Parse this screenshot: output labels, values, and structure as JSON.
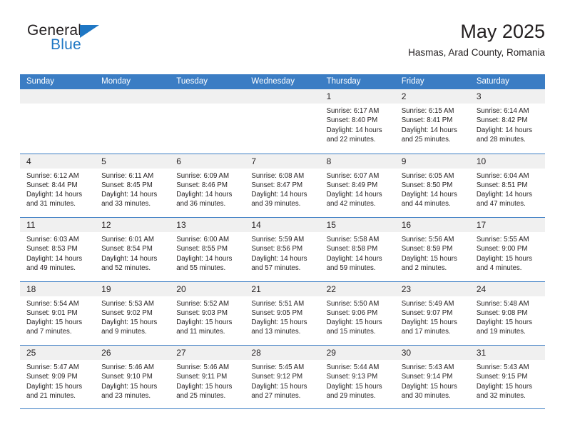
{
  "brand": {
    "word_one": "General",
    "word_two": "Blue",
    "triangle_icon": "brand-triangle-icon",
    "accent_color": "#1f77c4"
  },
  "header": {
    "month_title": "May 2025",
    "location": "Hasmas, Arad County, Romania"
  },
  "theme": {
    "header_bg": "#3b7dc4",
    "header_text": "#ffffff",
    "day_band_bg": "#f0f0f0",
    "cell_bg": "#ffffff",
    "text": "#231f20"
  },
  "weekdays": [
    "Sunday",
    "Monday",
    "Tuesday",
    "Wednesday",
    "Thursday",
    "Friday",
    "Saturday"
  ],
  "weeks": [
    [
      {
        "day": "",
        "sunrise": "",
        "sunset": "",
        "daylight_1": "",
        "daylight_2": "",
        "empty": true
      },
      {
        "day": "",
        "sunrise": "",
        "sunset": "",
        "daylight_1": "",
        "daylight_2": "",
        "empty": true
      },
      {
        "day": "",
        "sunrise": "",
        "sunset": "",
        "daylight_1": "",
        "daylight_2": "",
        "empty": true
      },
      {
        "day": "",
        "sunrise": "",
        "sunset": "",
        "daylight_1": "",
        "daylight_2": "",
        "empty": true
      },
      {
        "day": "1",
        "sunrise": "Sunrise: 6:17 AM",
        "sunset": "Sunset: 8:40 PM",
        "daylight_1": "Daylight: 14 hours",
        "daylight_2": "and 22 minutes."
      },
      {
        "day": "2",
        "sunrise": "Sunrise: 6:15 AM",
        "sunset": "Sunset: 8:41 PM",
        "daylight_1": "Daylight: 14 hours",
        "daylight_2": "and 25 minutes."
      },
      {
        "day": "3",
        "sunrise": "Sunrise: 6:14 AM",
        "sunset": "Sunset: 8:42 PM",
        "daylight_1": "Daylight: 14 hours",
        "daylight_2": "and 28 minutes."
      }
    ],
    [
      {
        "day": "4",
        "sunrise": "Sunrise: 6:12 AM",
        "sunset": "Sunset: 8:44 PM",
        "daylight_1": "Daylight: 14 hours",
        "daylight_2": "and 31 minutes."
      },
      {
        "day": "5",
        "sunrise": "Sunrise: 6:11 AM",
        "sunset": "Sunset: 8:45 PM",
        "daylight_1": "Daylight: 14 hours",
        "daylight_2": "and 33 minutes."
      },
      {
        "day": "6",
        "sunrise": "Sunrise: 6:09 AM",
        "sunset": "Sunset: 8:46 PM",
        "daylight_1": "Daylight: 14 hours",
        "daylight_2": "and 36 minutes."
      },
      {
        "day": "7",
        "sunrise": "Sunrise: 6:08 AM",
        "sunset": "Sunset: 8:47 PM",
        "daylight_1": "Daylight: 14 hours",
        "daylight_2": "and 39 minutes."
      },
      {
        "day": "8",
        "sunrise": "Sunrise: 6:07 AM",
        "sunset": "Sunset: 8:49 PM",
        "daylight_1": "Daylight: 14 hours",
        "daylight_2": "and 42 minutes."
      },
      {
        "day": "9",
        "sunrise": "Sunrise: 6:05 AM",
        "sunset": "Sunset: 8:50 PM",
        "daylight_1": "Daylight: 14 hours",
        "daylight_2": "and 44 minutes."
      },
      {
        "day": "10",
        "sunrise": "Sunrise: 6:04 AM",
        "sunset": "Sunset: 8:51 PM",
        "daylight_1": "Daylight: 14 hours",
        "daylight_2": "and 47 minutes."
      }
    ],
    [
      {
        "day": "11",
        "sunrise": "Sunrise: 6:03 AM",
        "sunset": "Sunset: 8:53 PM",
        "daylight_1": "Daylight: 14 hours",
        "daylight_2": "and 49 minutes."
      },
      {
        "day": "12",
        "sunrise": "Sunrise: 6:01 AM",
        "sunset": "Sunset: 8:54 PM",
        "daylight_1": "Daylight: 14 hours",
        "daylight_2": "and 52 minutes."
      },
      {
        "day": "13",
        "sunrise": "Sunrise: 6:00 AM",
        "sunset": "Sunset: 8:55 PM",
        "daylight_1": "Daylight: 14 hours",
        "daylight_2": "and 55 minutes."
      },
      {
        "day": "14",
        "sunrise": "Sunrise: 5:59 AM",
        "sunset": "Sunset: 8:56 PM",
        "daylight_1": "Daylight: 14 hours",
        "daylight_2": "and 57 minutes."
      },
      {
        "day": "15",
        "sunrise": "Sunrise: 5:58 AM",
        "sunset": "Sunset: 8:58 PM",
        "daylight_1": "Daylight: 14 hours",
        "daylight_2": "and 59 minutes."
      },
      {
        "day": "16",
        "sunrise": "Sunrise: 5:56 AM",
        "sunset": "Sunset: 8:59 PM",
        "daylight_1": "Daylight: 15 hours",
        "daylight_2": "and 2 minutes."
      },
      {
        "day": "17",
        "sunrise": "Sunrise: 5:55 AM",
        "sunset": "Sunset: 9:00 PM",
        "daylight_1": "Daylight: 15 hours",
        "daylight_2": "and 4 minutes."
      }
    ],
    [
      {
        "day": "18",
        "sunrise": "Sunrise: 5:54 AM",
        "sunset": "Sunset: 9:01 PM",
        "daylight_1": "Daylight: 15 hours",
        "daylight_2": "and 7 minutes."
      },
      {
        "day": "19",
        "sunrise": "Sunrise: 5:53 AM",
        "sunset": "Sunset: 9:02 PM",
        "daylight_1": "Daylight: 15 hours",
        "daylight_2": "and 9 minutes."
      },
      {
        "day": "20",
        "sunrise": "Sunrise: 5:52 AM",
        "sunset": "Sunset: 9:03 PM",
        "daylight_1": "Daylight: 15 hours",
        "daylight_2": "and 11 minutes."
      },
      {
        "day": "21",
        "sunrise": "Sunrise: 5:51 AM",
        "sunset": "Sunset: 9:05 PM",
        "daylight_1": "Daylight: 15 hours",
        "daylight_2": "and 13 minutes."
      },
      {
        "day": "22",
        "sunrise": "Sunrise: 5:50 AM",
        "sunset": "Sunset: 9:06 PM",
        "daylight_1": "Daylight: 15 hours",
        "daylight_2": "and 15 minutes."
      },
      {
        "day": "23",
        "sunrise": "Sunrise: 5:49 AM",
        "sunset": "Sunset: 9:07 PM",
        "daylight_1": "Daylight: 15 hours",
        "daylight_2": "and 17 minutes."
      },
      {
        "day": "24",
        "sunrise": "Sunrise: 5:48 AM",
        "sunset": "Sunset: 9:08 PM",
        "daylight_1": "Daylight: 15 hours",
        "daylight_2": "and 19 minutes."
      }
    ],
    [
      {
        "day": "25",
        "sunrise": "Sunrise: 5:47 AM",
        "sunset": "Sunset: 9:09 PM",
        "daylight_1": "Daylight: 15 hours",
        "daylight_2": "and 21 minutes."
      },
      {
        "day": "26",
        "sunrise": "Sunrise: 5:46 AM",
        "sunset": "Sunset: 9:10 PM",
        "daylight_1": "Daylight: 15 hours",
        "daylight_2": "and 23 minutes."
      },
      {
        "day": "27",
        "sunrise": "Sunrise: 5:46 AM",
        "sunset": "Sunset: 9:11 PM",
        "daylight_1": "Daylight: 15 hours",
        "daylight_2": "and 25 minutes."
      },
      {
        "day": "28",
        "sunrise": "Sunrise: 5:45 AM",
        "sunset": "Sunset: 9:12 PM",
        "daylight_1": "Daylight: 15 hours",
        "daylight_2": "and 27 minutes."
      },
      {
        "day": "29",
        "sunrise": "Sunrise: 5:44 AM",
        "sunset": "Sunset: 9:13 PM",
        "daylight_1": "Daylight: 15 hours",
        "daylight_2": "and 29 minutes."
      },
      {
        "day": "30",
        "sunrise": "Sunrise: 5:43 AM",
        "sunset": "Sunset: 9:14 PM",
        "daylight_1": "Daylight: 15 hours",
        "daylight_2": "and 30 minutes."
      },
      {
        "day": "31",
        "sunrise": "Sunrise: 5:43 AM",
        "sunset": "Sunset: 9:15 PM",
        "daylight_1": "Daylight: 15 hours",
        "daylight_2": "and 32 minutes."
      }
    ]
  ]
}
